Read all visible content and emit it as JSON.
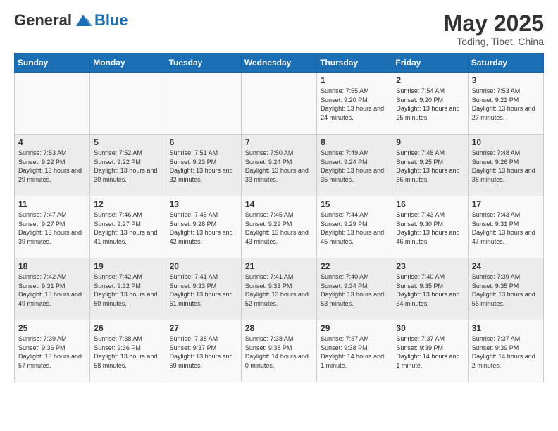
{
  "logo": {
    "general": "General",
    "blue": "Blue"
  },
  "header": {
    "month_year": "May 2025",
    "location": "Toding, Tibet, China"
  },
  "days_of_week": [
    "Sunday",
    "Monday",
    "Tuesday",
    "Wednesday",
    "Thursday",
    "Friday",
    "Saturday"
  ],
  "weeks": [
    [
      {
        "day": "",
        "info": ""
      },
      {
        "day": "",
        "info": ""
      },
      {
        "day": "",
        "info": ""
      },
      {
        "day": "",
        "info": ""
      },
      {
        "day": "1",
        "info": "Sunrise: 7:55 AM\nSunset: 9:20 PM\nDaylight: 13 hours and 24 minutes."
      },
      {
        "day": "2",
        "info": "Sunrise: 7:54 AM\nSunset: 9:20 PM\nDaylight: 13 hours and 25 minutes."
      },
      {
        "day": "3",
        "info": "Sunrise: 7:53 AM\nSunset: 9:21 PM\nDaylight: 13 hours and 27 minutes."
      }
    ],
    [
      {
        "day": "4",
        "info": "Sunrise: 7:53 AM\nSunset: 9:22 PM\nDaylight: 13 hours and 29 minutes."
      },
      {
        "day": "5",
        "info": "Sunrise: 7:52 AM\nSunset: 9:22 PM\nDaylight: 13 hours and 30 minutes."
      },
      {
        "day": "6",
        "info": "Sunrise: 7:51 AM\nSunset: 9:23 PM\nDaylight: 13 hours and 32 minutes."
      },
      {
        "day": "7",
        "info": "Sunrise: 7:50 AM\nSunset: 9:24 PM\nDaylight: 13 hours and 33 minutes."
      },
      {
        "day": "8",
        "info": "Sunrise: 7:49 AM\nSunset: 9:24 PM\nDaylight: 13 hours and 35 minutes."
      },
      {
        "day": "9",
        "info": "Sunrise: 7:48 AM\nSunset: 9:25 PM\nDaylight: 13 hours and 36 minutes."
      },
      {
        "day": "10",
        "info": "Sunrise: 7:48 AM\nSunset: 9:26 PM\nDaylight: 13 hours and 38 minutes."
      }
    ],
    [
      {
        "day": "11",
        "info": "Sunrise: 7:47 AM\nSunset: 9:27 PM\nDaylight: 13 hours and 39 minutes."
      },
      {
        "day": "12",
        "info": "Sunrise: 7:46 AM\nSunset: 9:27 PM\nDaylight: 13 hours and 41 minutes."
      },
      {
        "day": "13",
        "info": "Sunrise: 7:45 AM\nSunset: 9:28 PM\nDaylight: 13 hours and 42 minutes."
      },
      {
        "day": "14",
        "info": "Sunrise: 7:45 AM\nSunset: 9:29 PM\nDaylight: 13 hours and 43 minutes."
      },
      {
        "day": "15",
        "info": "Sunrise: 7:44 AM\nSunset: 9:29 PM\nDaylight: 13 hours and 45 minutes."
      },
      {
        "day": "16",
        "info": "Sunrise: 7:43 AM\nSunset: 9:30 PM\nDaylight: 13 hours and 46 minutes."
      },
      {
        "day": "17",
        "info": "Sunrise: 7:43 AM\nSunset: 9:31 PM\nDaylight: 13 hours and 47 minutes."
      }
    ],
    [
      {
        "day": "18",
        "info": "Sunrise: 7:42 AM\nSunset: 9:31 PM\nDaylight: 13 hours and 49 minutes."
      },
      {
        "day": "19",
        "info": "Sunrise: 7:42 AM\nSunset: 9:32 PM\nDaylight: 13 hours and 50 minutes."
      },
      {
        "day": "20",
        "info": "Sunrise: 7:41 AM\nSunset: 9:33 PM\nDaylight: 13 hours and 51 minutes."
      },
      {
        "day": "21",
        "info": "Sunrise: 7:41 AM\nSunset: 9:33 PM\nDaylight: 13 hours and 52 minutes."
      },
      {
        "day": "22",
        "info": "Sunrise: 7:40 AM\nSunset: 9:34 PM\nDaylight: 13 hours and 53 minutes."
      },
      {
        "day": "23",
        "info": "Sunrise: 7:40 AM\nSunset: 9:35 PM\nDaylight: 13 hours and 54 minutes."
      },
      {
        "day": "24",
        "info": "Sunrise: 7:39 AM\nSunset: 9:35 PM\nDaylight: 13 hours and 56 minutes."
      }
    ],
    [
      {
        "day": "25",
        "info": "Sunrise: 7:39 AM\nSunset: 9:36 PM\nDaylight: 13 hours and 57 minutes."
      },
      {
        "day": "26",
        "info": "Sunrise: 7:38 AM\nSunset: 9:36 PM\nDaylight: 13 hours and 58 minutes."
      },
      {
        "day": "27",
        "info": "Sunrise: 7:38 AM\nSunset: 9:37 PM\nDaylight: 13 hours and 59 minutes."
      },
      {
        "day": "28",
        "info": "Sunrise: 7:38 AM\nSunset: 9:38 PM\nDaylight: 14 hours and 0 minutes."
      },
      {
        "day": "29",
        "info": "Sunrise: 7:37 AM\nSunset: 9:38 PM\nDaylight: 14 hours and 1 minute."
      },
      {
        "day": "30",
        "info": "Sunrise: 7:37 AM\nSunset: 9:39 PM\nDaylight: 14 hours and 1 minute."
      },
      {
        "day": "31",
        "info": "Sunrise: 7:37 AM\nSunset: 9:39 PM\nDaylight: 14 hours and 2 minutes."
      }
    ]
  ]
}
